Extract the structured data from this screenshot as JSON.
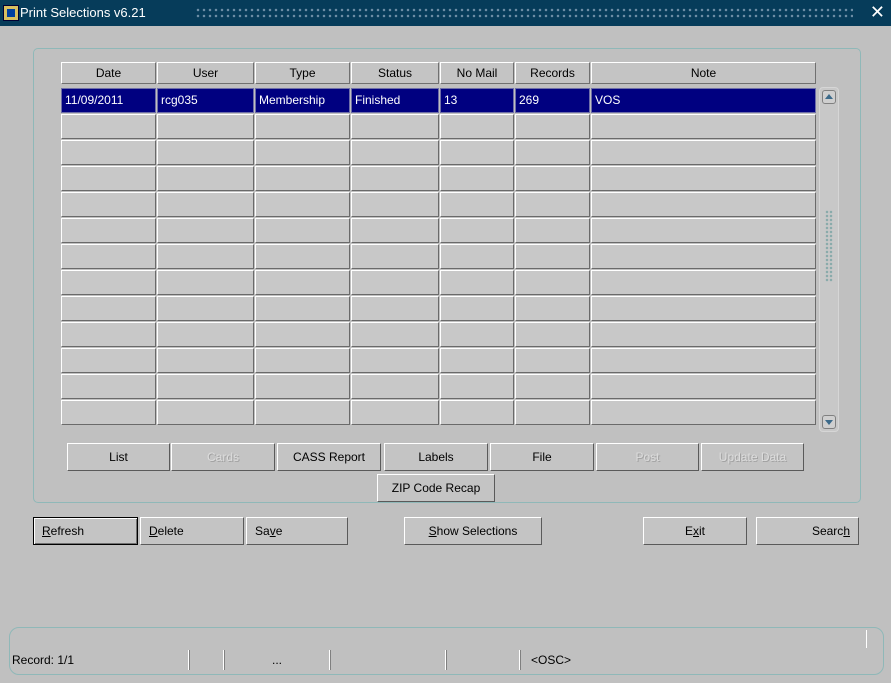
{
  "window": {
    "title": "Print Selections v6.21",
    "close_glyph": "✕"
  },
  "table": {
    "columns": [
      "Date",
      "User",
      "Type",
      "Status",
      "No Mail",
      "Records",
      "Note"
    ],
    "rows": [
      [
        "11/09/2011",
        "rcg035",
        "Membership",
        "Finished",
        "13",
        "269",
        "VOS"
      ],
      [
        "",
        "",
        "",
        "",
        "",
        "",
        ""
      ],
      [
        "",
        "",
        "",
        "",
        "",
        "",
        ""
      ],
      [
        "",
        "",
        "",
        "",
        "",
        "",
        ""
      ],
      [
        "",
        "",
        "",
        "",
        "",
        "",
        ""
      ],
      [
        "",
        "",
        "",
        "",
        "",
        "",
        ""
      ],
      [
        "",
        "",
        "",
        "",
        "",
        "",
        ""
      ],
      [
        "",
        "",
        "",
        "",
        "",
        "",
        ""
      ],
      [
        "",
        "",
        "",
        "",
        "",
        "",
        ""
      ],
      [
        "",
        "",
        "",
        "",
        "",
        "",
        ""
      ],
      [
        "",
        "",
        "",
        "",
        "",
        "",
        ""
      ],
      [
        "",
        "",
        "",
        "",
        "",
        "",
        ""
      ],
      [
        "",
        "",
        "",
        "",
        "",
        "",
        ""
      ]
    ],
    "selected_row": 0
  },
  "print_buttons": {
    "list": "List",
    "cards": "Cards",
    "cass_report": "CASS Report",
    "labels": "Labels",
    "file": "File",
    "post": "Post",
    "update_data": "Update Data",
    "zip_code_recap": "ZIP Code Recap"
  },
  "actions": {
    "refresh": {
      "pre": "",
      "key": "R",
      "post": "efresh"
    },
    "delete": {
      "pre": "",
      "key": "D",
      "post": "elete"
    },
    "save": {
      "pre": "Sa",
      "key": "v",
      "post": "e"
    },
    "show_selections": {
      "pre": "",
      "key": "S",
      "post": "how Selections"
    },
    "exit": {
      "pre": "E",
      "key": "x",
      "post": "it"
    },
    "search": {
      "pre": "Searc",
      "key": "h",
      "post": ""
    }
  },
  "status": {
    "record": "Record: 1/1",
    "ellipsis": "...",
    "mode": "<OSC>"
  },
  "colors": {
    "titlebar": "#063c5a",
    "selection": "#000080",
    "background": "#c0c0c0"
  }
}
